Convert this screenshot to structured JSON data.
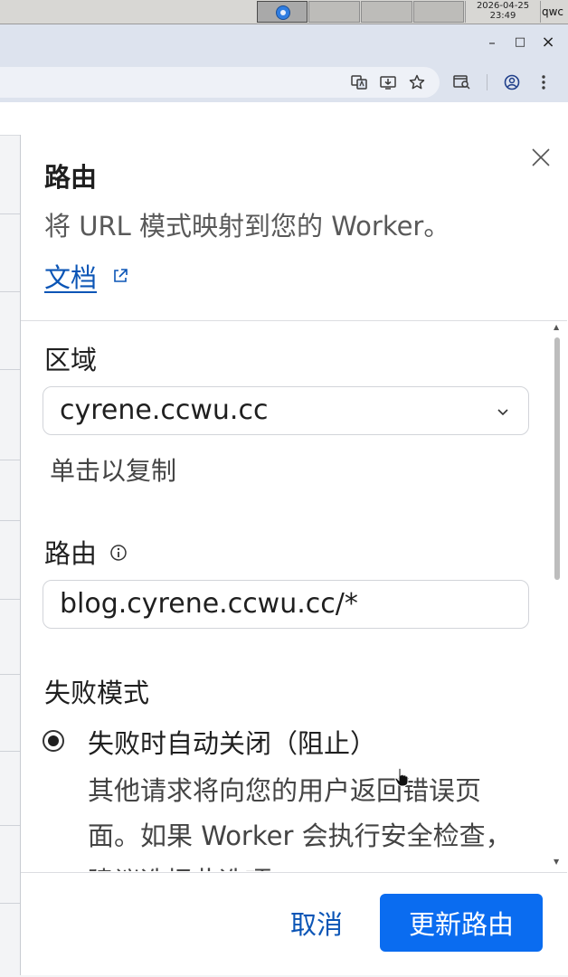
{
  "system": {
    "clock_date": "2026-04-25",
    "clock_time": "23:49",
    "user": "qwc"
  },
  "browser": {
    "minimize": "–",
    "maximize": "□",
    "close": "×",
    "toolbar_icons": [
      "translate-icon",
      "install-app-icon",
      "bookmark-star-icon",
      "search-tab-icon",
      "profile-icon",
      "menu-icon"
    ]
  },
  "panel": {
    "title": "路由",
    "description": "将 URL 模式映射到您的 Worker。",
    "docs_link": "文档",
    "zone": {
      "label": "区域",
      "selected_value": "cyrene.ccwu.cc",
      "hint": "单击以复制"
    },
    "route": {
      "label": "路由",
      "value": "blog.cyrene.ccwu.cc/*"
    },
    "failure_mode": {
      "label": "失败模式",
      "option_label": "失败时自动关闭（阻止）",
      "option_description": "其他请求将向您的用户返回错误页面。如果 Worker 会执行安全检查，建议选择此选项。"
    },
    "footer": {
      "cancel_label": "取消",
      "update_label": "更新路由"
    }
  },
  "colors": {
    "accent": "#0a6cf0",
    "link": "#0b55b6"
  }
}
